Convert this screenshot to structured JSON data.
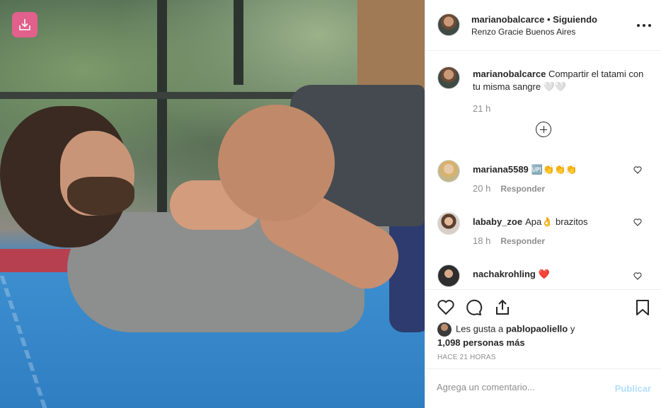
{
  "post": {
    "author": "marianobalcarce",
    "follow_status": "• Siguiendo",
    "location": "Renzo Gracie Buenos Aires"
  },
  "caption": {
    "author": "marianobalcarce",
    "text": "Compartir el tatami con tu misma sangre 🤍🤍",
    "time": "21 h"
  },
  "comments": [
    {
      "user": "mariana5589",
      "text": "🆙👏👏👏",
      "time": "20 h",
      "reply_label": "Responder"
    },
    {
      "user": "lababy_zoe",
      "text": "Apa👌 brazitos",
      "time": "18 h",
      "reply_label": "Responder"
    },
    {
      "user": "nachakrohling",
      "text": "❤️",
      "time": "",
      "reply_label": ""
    }
  ],
  "likes": {
    "prefix": "Les gusta a",
    "user": "pablopaoliello",
    "suffix": "y",
    "count": "1,098 personas más"
  },
  "timestamp": "HACE 21 HORAS",
  "composer": {
    "placeholder": "Agrega un comentario...",
    "publish_label": "Publicar"
  },
  "colors": {
    "download_button": "#e1608c",
    "heart": "#c0282e",
    "publish_disabled": "#b2dffc"
  }
}
